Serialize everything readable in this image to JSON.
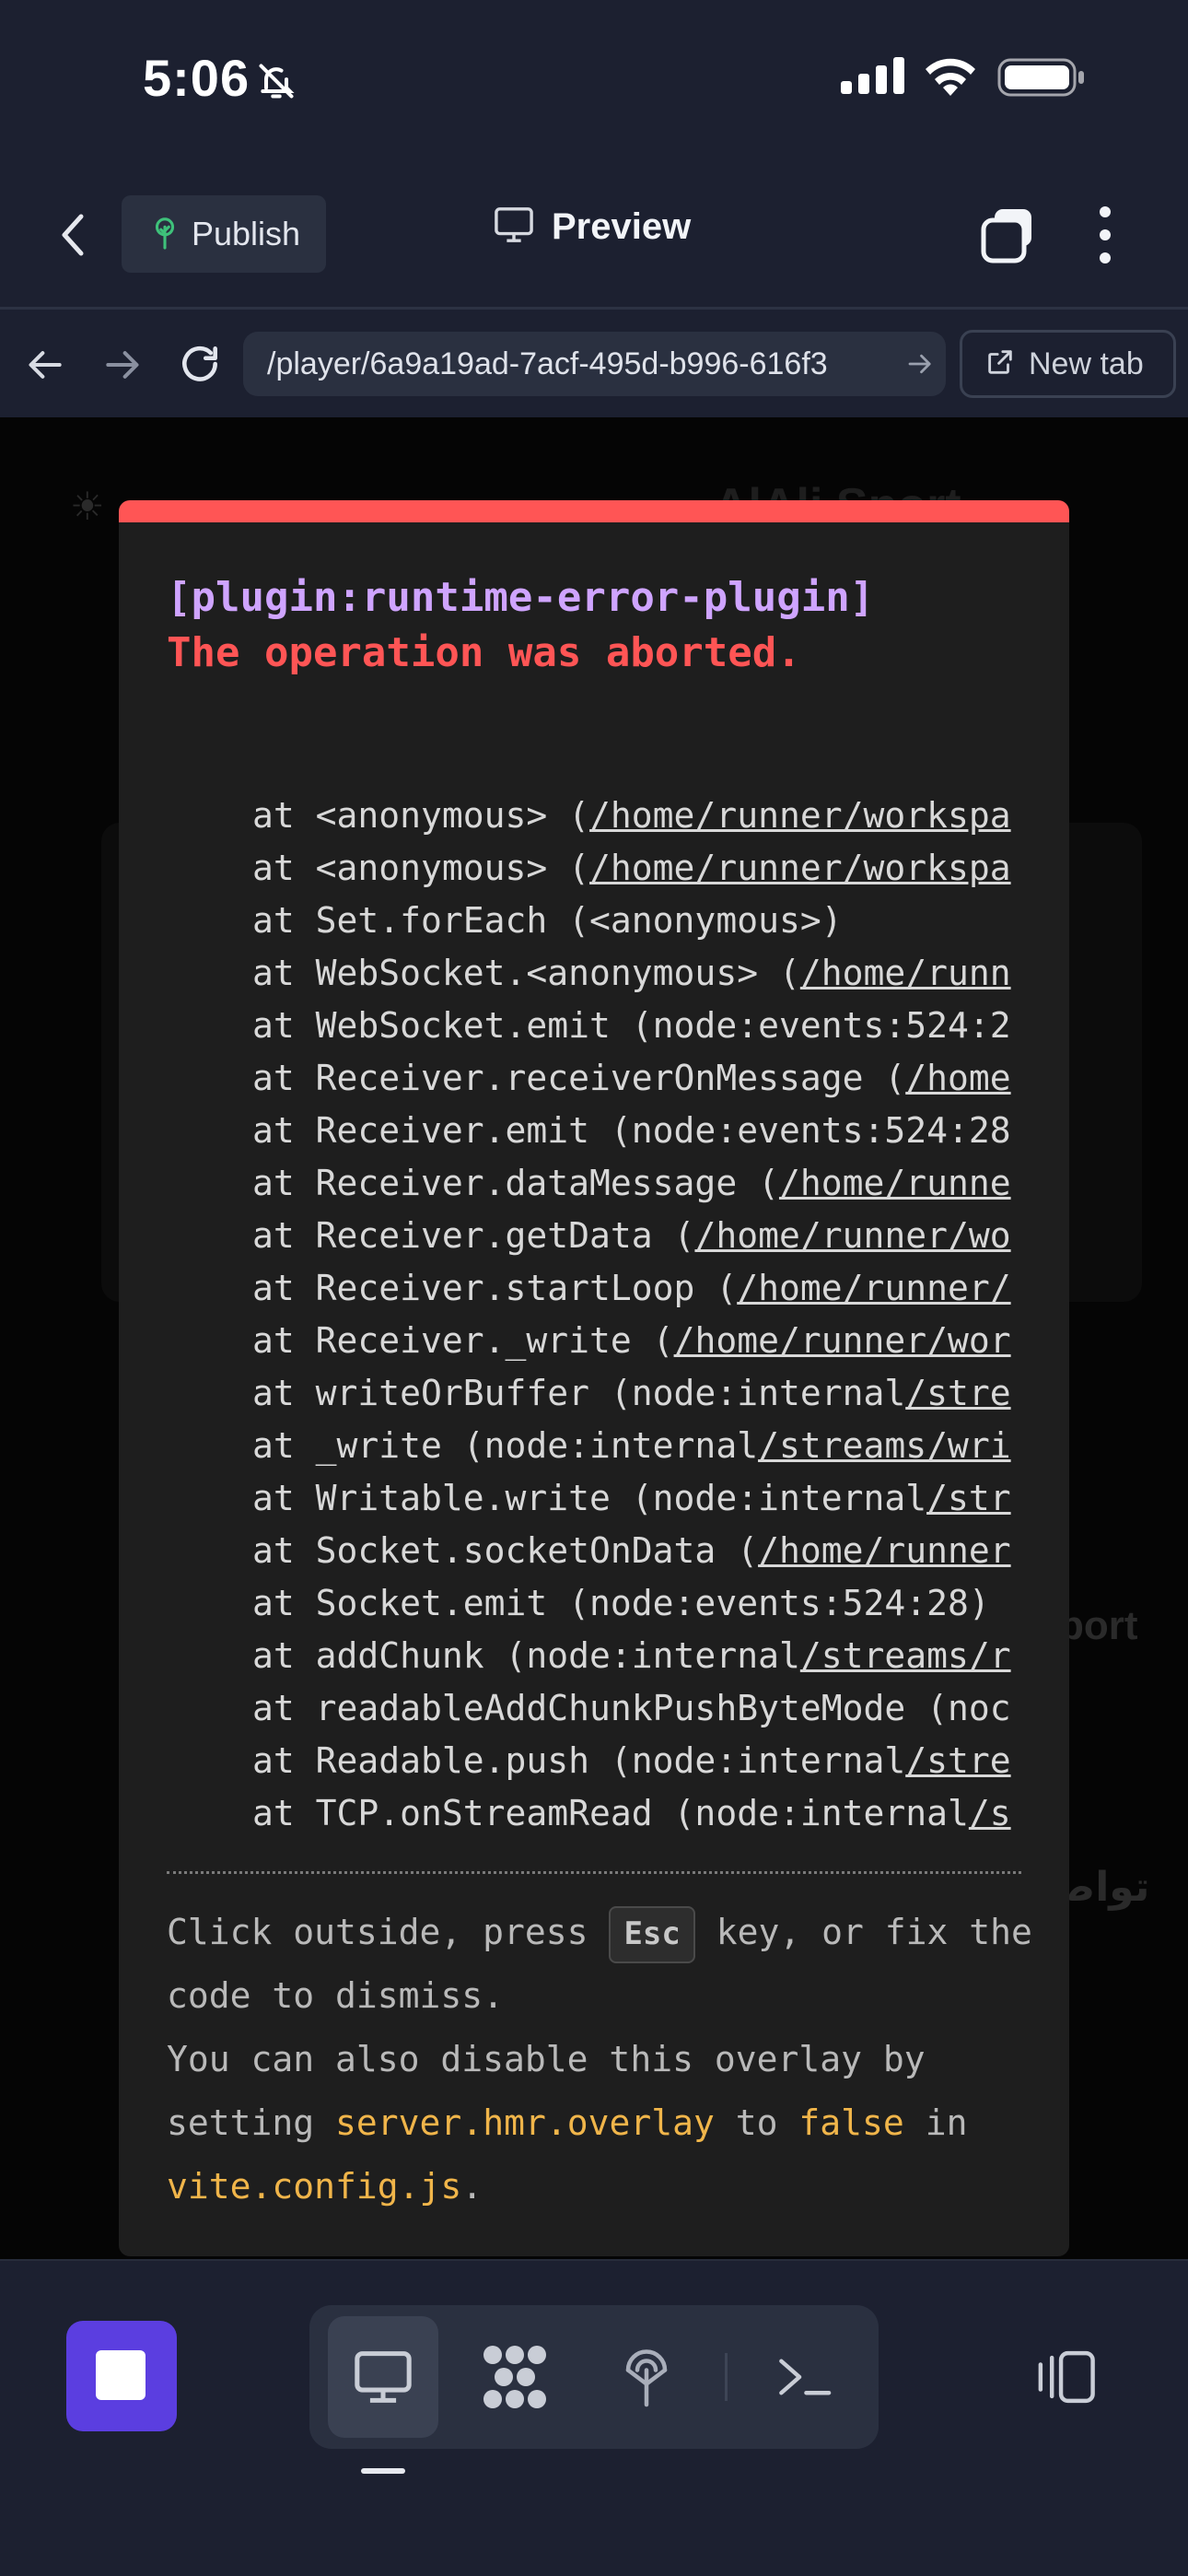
{
  "status": {
    "time": "5:06"
  },
  "header": {
    "publish_label": "Publish",
    "preview_label": "Preview"
  },
  "url_bar": {
    "url": "/player/6a9a19ad-7acf-495d-b996-616f3",
    "new_tab_label": "New tab"
  },
  "background": {
    "title": "AlAli Sport",
    "snippet_right": "port",
    "snippet_right2": "تواص"
  },
  "overlay": {
    "plugin": "[plugin:runtime-error-plugin]",
    "message": "The operation was aborted.",
    "stack": [
      [
        "at <anonymous> (",
        "/home/runner/workspa",
        ""
      ],
      [
        "at <anonymous> (",
        "/home/runner/workspa",
        ""
      ],
      [
        "at Set.forEach (<anonymous>)",
        "",
        ""
      ],
      [
        "at WebSocket.<anonymous> (",
        "/home/runn",
        ""
      ],
      [
        "at WebSocket.emit (node:events:524:2",
        "",
        ""
      ],
      [
        "at Receiver.receiverOnMessage (",
        "/home",
        ""
      ],
      [
        "at Receiver.emit (node:events:524:28",
        "",
        ""
      ],
      [
        "at Receiver.dataMessage (",
        "/home/runne",
        ""
      ],
      [
        "at Receiver.getData (",
        "/home/runner/wo",
        ""
      ],
      [
        "at Receiver.startLoop (",
        "/home/runner/",
        ""
      ],
      [
        "at Receiver._write (",
        "/home/runner/wor",
        ""
      ],
      [
        "at writeOrBuffer (node:internal",
        "/stre",
        ""
      ],
      [
        "at _write (node:internal",
        "/streams/wri",
        ""
      ],
      [
        "at Writable.write (node:internal",
        "/str",
        ""
      ],
      [
        "at Socket.socketOnData (",
        "/home/runner",
        ""
      ],
      [
        "at Socket.emit (node:events:524:28)",
        "",
        ""
      ],
      [
        "at addChunk (node:internal",
        "/streams/r",
        ""
      ],
      [
        "at readableAddChunkPushByteMode (noc",
        "",
        ""
      ],
      [
        "at Readable.push (node:internal",
        "/stre",
        ""
      ],
      [
        "at TCP.onStreamRead (node:internal",
        "/s",
        ""
      ]
    ],
    "tip_1": "Click outside, press",
    "tip_key": "Esc",
    "tip_2": "key, or fix the code to dismiss.",
    "tip_3": "You can also disable this overlay by setting",
    "tip_code1": "server.hmr.overlay",
    "tip_4": "to",
    "tip_code2": "false",
    "tip_5": "in",
    "tip_code3": "vite.config.js",
    "tip_6": "."
  },
  "colors": {
    "accent": "#5b3ee0",
    "error_red": "#ff5555",
    "plugin_purple": "#cfa4ff",
    "code_yellow": "#f0b54a"
  },
  "icons": [
    "bell-off-icon",
    "signal-icon",
    "wifi-icon",
    "battery-icon",
    "chevron-left-icon",
    "tree-icon",
    "monitor-icon",
    "tabs-icon",
    "kebab-icon",
    "arrow-left-icon",
    "arrow-right-icon",
    "reload-icon",
    "external-link-icon",
    "sun-icon",
    "grid-icon",
    "antenna-icon",
    "terminal-icon",
    "panel-icon"
  ]
}
